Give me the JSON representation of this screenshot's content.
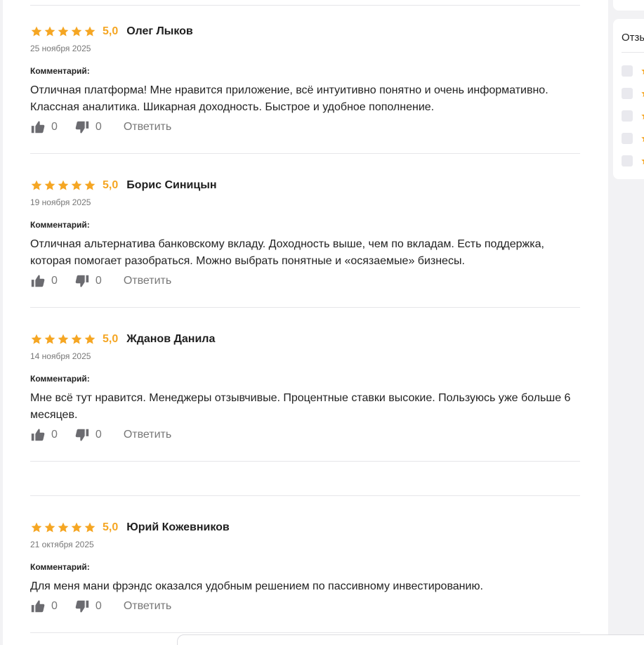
{
  "reviews": [
    {
      "rating": "5,0",
      "stars": 5,
      "author": "Олег Лыков",
      "date": "25 ноября 2025",
      "comment_label": "Комментарий:",
      "comment": "Отличная платформа! Мне нравится приложение, всё интуитивно понятно и очень информативно. Классная аналитика. Шикарная доходность. Быстрое и удобное пополнение.",
      "likes": "0",
      "dislikes": "0",
      "reply_label": "Ответить"
    },
    {
      "rating": "5,0",
      "stars": 5,
      "author": "Борис Синицын",
      "date": "19 ноября 2025",
      "comment_label": "Комментарий:",
      "comment": "Отличная альтернатива банковскому вкладу. Доходность выше, чем по вкладам. Есть поддержка, которая помогает разобраться. Можно выбрать понятные и «осязаемые» бизнесы.",
      "likes": "0",
      "dislikes": "0",
      "reply_label": "Ответить"
    },
    {
      "rating": "5,0",
      "stars": 5,
      "author": "Жданов Данила",
      "date": "14 ноября 2025",
      "comment_label": "Комментарий:",
      "comment": "Мне всё тут нравится. Менеджеры отзывчивые. Процентные ставки высокие. Пользуюсь уже больше 6 месяцев.",
      "likes": "0",
      "dislikes": "0",
      "reply_label": "Ответить"
    },
    {
      "rating": "5,0",
      "stars": 5,
      "author": "Юрий Кожевников",
      "date": "21 октября 2025",
      "comment_label": "Комментарий:",
      "comment": "Для меня мани фрэндс оказался удобным решением по пассивному инвестированию.",
      "likes": "0",
      "dislikes": "0",
      "reply_label": "Ответить"
    }
  ],
  "sidebar": {
    "title": "Отзы"
  },
  "colors": {
    "star": "#f5a623",
    "muted": "#777777",
    "icon": "#6b6b70"
  },
  "icons": {
    "star": "star-icon",
    "like": "thumbs-up-icon",
    "dislike": "thumbs-down-icon"
  }
}
